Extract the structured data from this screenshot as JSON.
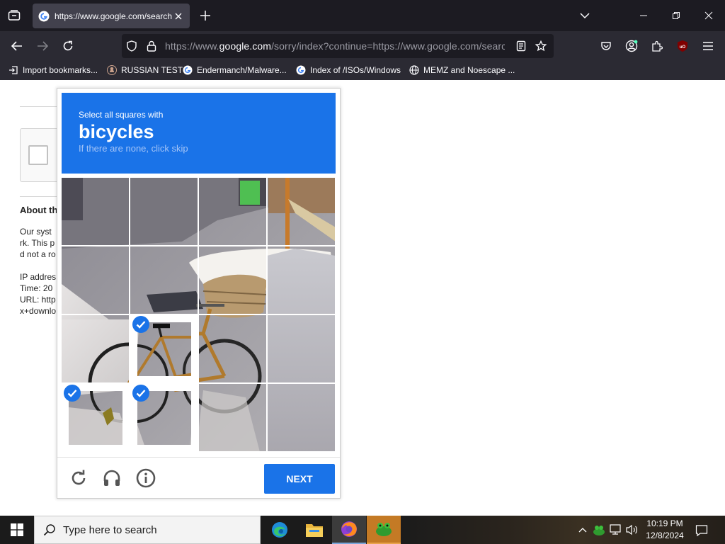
{
  "browser": {
    "tab": {
      "title": "https://www.google.com/search"
    },
    "url": {
      "prefix": "https://www.",
      "domain": "google.com",
      "rest": "/sorry/index?continue=https://www.google.com/search"
    },
    "bookmarks": [
      {
        "label": "Import bookmarks...",
        "icon": "import-icon"
      },
      {
        "label": "RUSSIAN TEST",
        "icon": "github-icon"
      },
      {
        "label": "Endermanch/Malware...",
        "icon": "google-icon"
      },
      {
        "label": "Index of /ISOs/Windows",
        "icon": "google-icon"
      },
      {
        "label": "MEMZ and Noescape ...",
        "icon": "globe-icon"
      }
    ],
    "colors": {
      "chrome_dark": "#1c1b22",
      "chrome": "#2b2a33",
      "tab_active": "#42414d"
    }
  },
  "page": {
    "heading": "About th",
    "lines": [
      "Our syst",
      "rk. This p",
      "d not a ro",
      "",
      "IP addres",
      "Time: 20",
      "URL: http",
      "x+downlo"
    ]
  },
  "captcha": {
    "instruction": "Select all squares with",
    "target": "bicycles",
    "hint": "If there are none, click skip",
    "tiles": [
      [
        false,
        false,
        false,
        false
      ],
      [
        false,
        false,
        false,
        false
      ],
      [
        false,
        true,
        false,
        false
      ],
      [
        true,
        true,
        false,
        false
      ]
    ],
    "next_label": "NEXT",
    "colors": {
      "accent": "#1a73e8"
    }
  },
  "taskbar": {
    "search_placeholder": "Type here to search",
    "apps": [
      "edge-icon",
      "file-explorer-icon",
      "firefox-icon",
      "app-icon"
    ],
    "time": "10:19 PM",
    "date": "12/8/2024"
  }
}
